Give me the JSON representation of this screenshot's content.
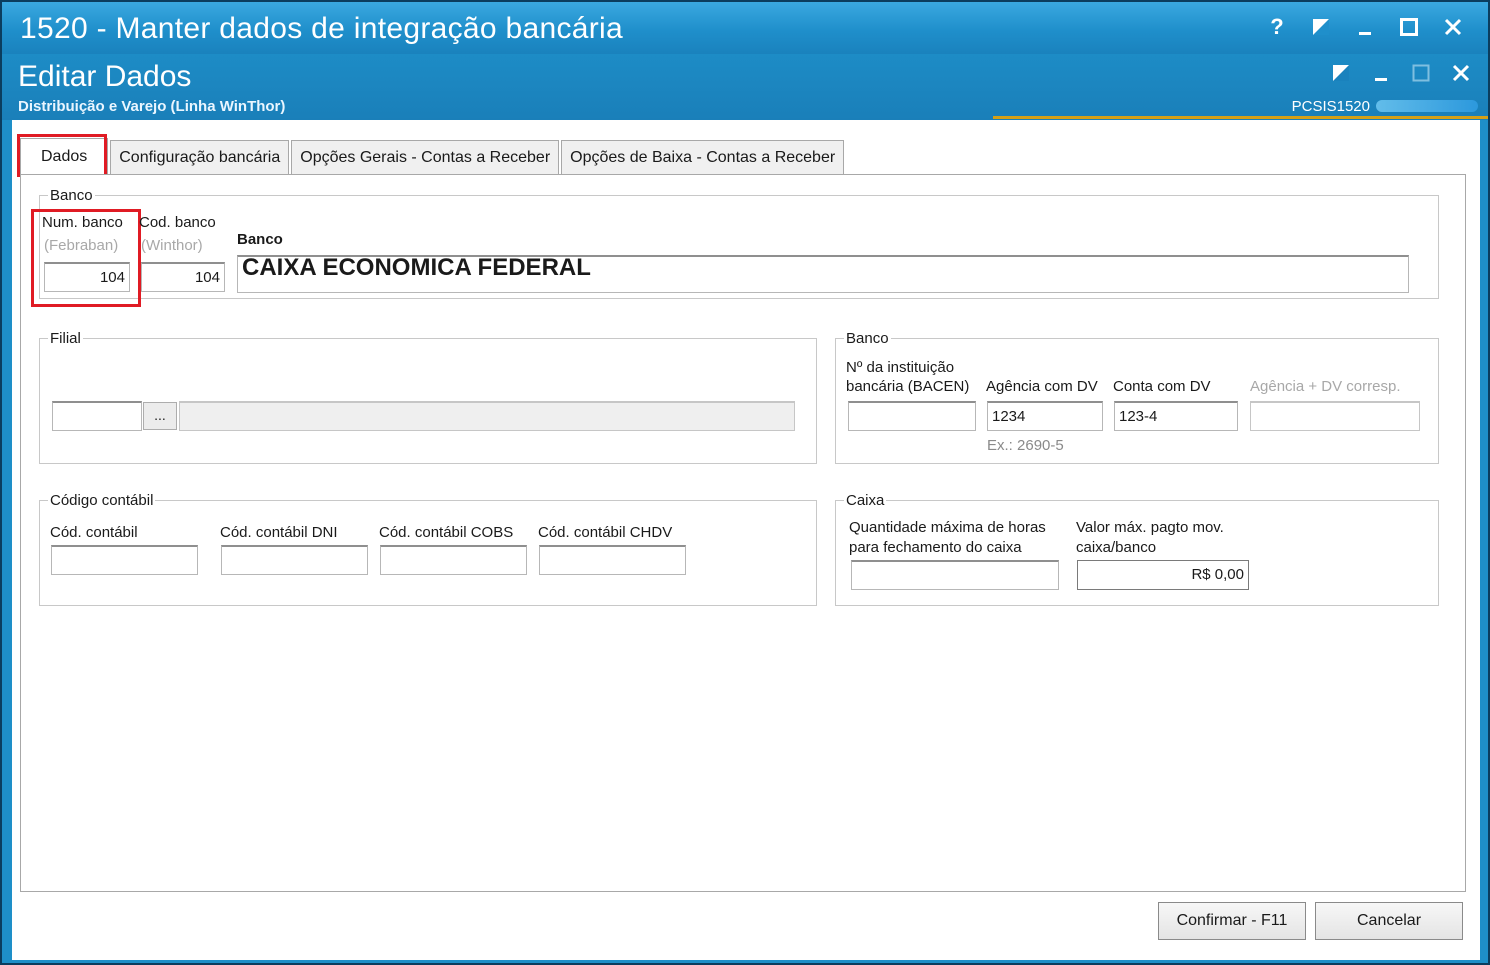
{
  "window": {
    "title": "1520 - Manter dados de integração bancária",
    "controls": [
      "help-icon",
      "restore-edit-icon",
      "minimize-icon",
      "maximize-icon",
      "close-icon"
    ]
  },
  "form": {
    "title": "Editar Dados",
    "caption": "Distribuição e Varejo (Linha WinThor)",
    "program_code": "PCSIS1520"
  },
  "tabs": [
    {
      "label": "Dados",
      "active": true
    },
    {
      "label": "Configuração bancária"
    },
    {
      "label": "Opções Gerais - Contas a Receber"
    },
    {
      "label": "Opções de Baixa - Contas a Receber"
    }
  ],
  "banco_group": {
    "legend": "Banco",
    "num_banco_label": "Num. banco",
    "num_banco_sub": "(Febraban)",
    "num_banco_value": "104",
    "cod_banco_label": "Cod. banco",
    "cod_banco_sub": "(Winthor)",
    "cod_banco_value": "104",
    "banco_label": "Banco",
    "banco_value": "CAIXA ECONÔMICA FEDERAL"
  },
  "filial_group": {
    "legend": "Filial",
    "code_value": "",
    "ellipsis_label": "...",
    "name_value": ""
  },
  "banco2_group": {
    "legend": "Banco",
    "instituicao_label_1": "Nº da instituição",
    "instituicao_label_2": "bancária (BACEN)",
    "instituicao_value": "",
    "agencia_label": "Agência com DV",
    "agencia_value": "1234",
    "agencia_hint": "Ex.: 2690-5",
    "conta_label": "Conta com DV",
    "conta_value": "123-4",
    "agencia_corresp_label": "Agência + DV corresp.",
    "agencia_corresp_value": ""
  },
  "contabil_group": {
    "legend": "Código contábil",
    "fields": [
      {
        "label": "Cód. contábil",
        "value": ""
      },
      {
        "label": "Cód. contábil DNI",
        "value": ""
      },
      {
        "label": "Cód. contábil COBS",
        "value": ""
      },
      {
        "label": "Cód. contábil CHDV",
        "value": ""
      }
    ]
  },
  "caixa_group": {
    "legend": "Caixa",
    "horas_label_1": "Quantidade máxima de horas",
    "horas_label_2": "para fechamento do caixa",
    "horas_value": "",
    "valor_label_1": "Valor máx. pagto mov.",
    "valor_label_2": "caixa/banco",
    "valor_value": "R$ 0,00"
  },
  "buttons": {
    "confirm": "Confirmar - F11",
    "cancel": "Cancelar"
  },
  "colors": {
    "titlebar": "#1f8fcb",
    "highlight": "#e01b24",
    "accent_line": "#d4a017"
  }
}
